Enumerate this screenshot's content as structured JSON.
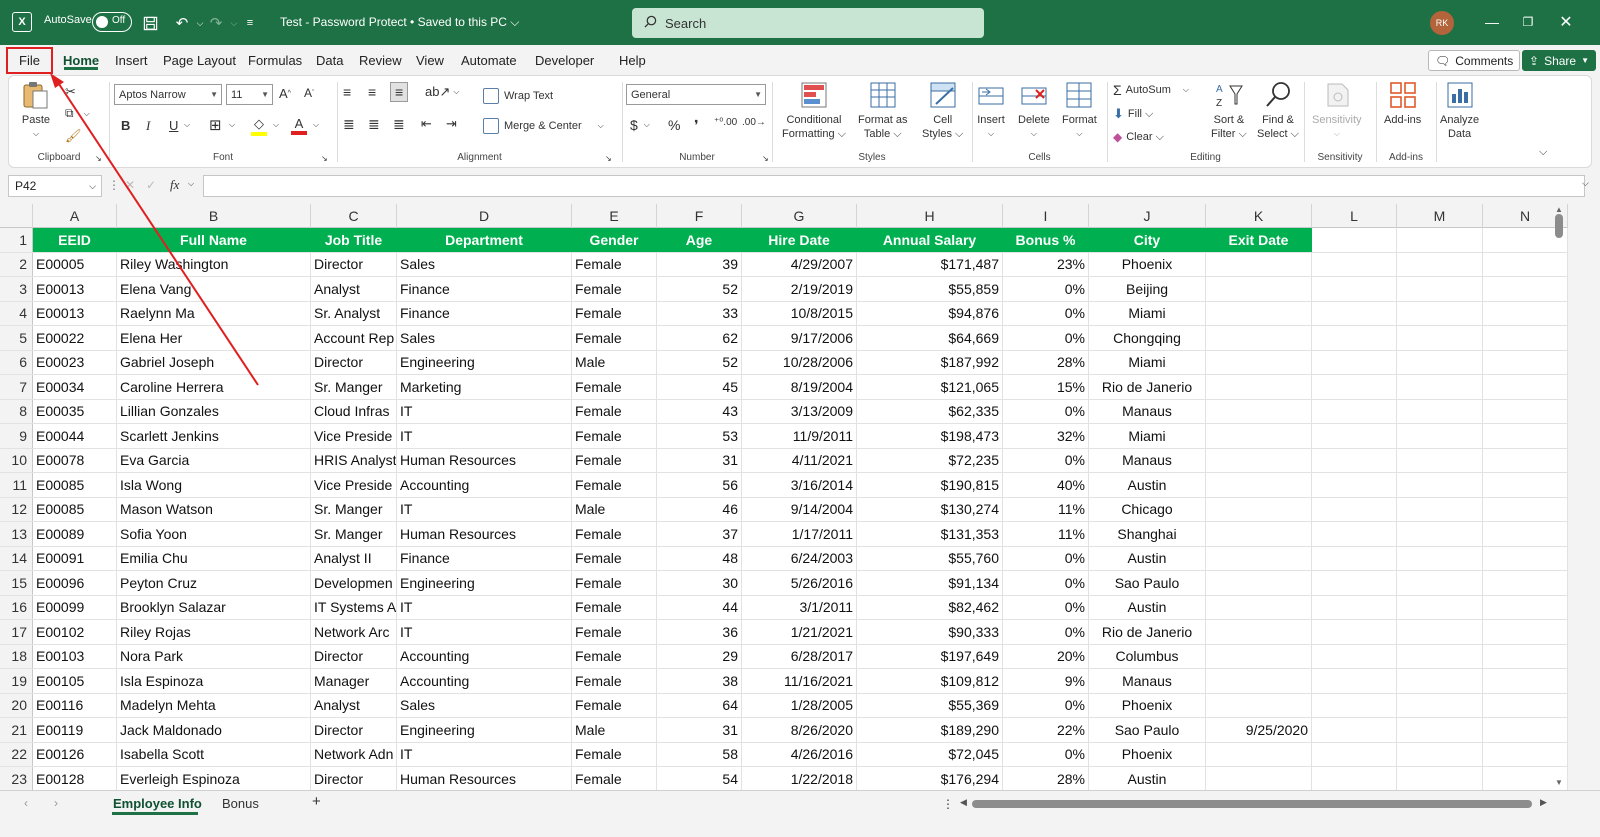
{
  "title_bar": {
    "autosave_label": "AutoSave",
    "autosave_state": "Off",
    "document_title": "Test - Password Protect • Saved to this PC ⌵",
    "search_placeholder": "Search",
    "user_initials": "RK",
    "bg_color": "#1e7145"
  },
  "menu": {
    "tabs": [
      "File",
      "Home",
      "Insert",
      "Page Layout",
      "Formulas",
      "Data",
      "Review",
      "View",
      "Automate",
      "Developer",
      "Help"
    ],
    "active_tab": "Home",
    "highlighted_tab": "File",
    "comments_label": "Comments",
    "share_label": "Share"
  },
  "ribbon": {
    "clipboard": {
      "paste": "Paste",
      "group": "Clipboard"
    },
    "font": {
      "name": "Aptos Narrow",
      "size": "11",
      "group": "Font"
    },
    "alignment": {
      "wrap": "Wrap Text",
      "merge": "Merge & Center",
      "group": "Alignment"
    },
    "number": {
      "format": "General",
      "group": "Number"
    },
    "styles": {
      "conditional_1": "Conditional",
      "conditional_2": "Formatting ⌵",
      "format_table_1": "Format as",
      "format_table_2": "Table ⌵",
      "cell_styles_1": "Cell",
      "cell_styles_2": "Styles ⌵",
      "group": "Styles"
    },
    "cells": {
      "insert": "Insert",
      "delete": "Delete",
      "format": "Format",
      "group": "Cells"
    },
    "editing": {
      "autosum": "AutoSum",
      "fill": "Fill ⌵",
      "clear": "Clear ⌵",
      "sort_1": "Sort &",
      "sort_2": "Filter ⌵",
      "find_1": "Find &",
      "find_2": "Select ⌵",
      "group": "Editing"
    },
    "sensitivity": {
      "label": "Sensitivity",
      "group": "Sensitivity"
    },
    "addins": {
      "label": "Add-ins",
      "group": "Add-ins"
    },
    "analyze": {
      "label_1": "Analyze",
      "label_2": "Data"
    }
  },
  "formula_bar": {
    "name_box": "P42",
    "fx": "fx",
    "value": ""
  },
  "columns": [
    "A",
    "B",
    "C",
    "D",
    "E",
    "F",
    "G",
    "H",
    "I",
    "J",
    "K",
    "L",
    "M",
    "N"
  ],
  "headers": [
    "EEID",
    "Full Name",
    "Job Title",
    "Department",
    "Gender",
    "Age",
    "Hire Date",
    "Annual Salary",
    "Bonus %",
    "City",
    "Exit Date"
  ],
  "rows": [
    [
      "E00005",
      "Riley Washington",
      "Director",
      "Sales",
      "Female",
      "39",
      "4/29/2007",
      "$171,487",
      "23%",
      "Phoenix",
      ""
    ],
    [
      "E00013",
      "Elena Vang",
      "Analyst",
      "Finance",
      "Female",
      "52",
      "2/19/2019",
      "$55,859",
      "0%",
      "Beijing",
      ""
    ],
    [
      "E00013",
      "Raelynn Ma",
      "Sr. Analyst",
      "Finance",
      "Female",
      "33",
      "10/8/2015",
      "$94,876",
      "0%",
      "Miami",
      ""
    ],
    [
      "E00022",
      "Elena Her",
      "Account Rep",
      "Sales",
      "Female",
      "62",
      "9/17/2006",
      "$64,669",
      "0%",
      "Chongqing",
      ""
    ],
    [
      "E00023",
      "Gabriel Joseph",
      "Director",
      "Engineering",
      "Male",
      "52",
      "10/28/2006",
      "$187,992",
      "28%",
      "Miami",
      ""
    ],
    [
      "E00034",
      "Caroline Herrera",
      "Sr. Manger",
      "Marketing",
      "Female",
      "45",
      "8/19/2004",
      "$121,065",
      "15%",
      "Rio de Janerio",
      ""
    ],
    [
      "E00035",
      "Lillian Gonzales",
      "Cloud Infras",
      "IT",
      "Female",
      "43",
      "3/13/2009",
      "$62,335",
      "0%",
      "Manaus",
      ""
    ],
    [
      "E00044",
      "Scarlett Jenkins",
      "Vice Preside",
      "IT",
      "Female",
      "53",
      "11/9/2011",
      "$198,473",
      "32%",
      "Miami",
      ""
    ],
    [
      "E00078",
      "Eva Garcia",
      "HRIS Analyst",
      "Human Resources",
      "Female",
      "31",
      "4/11/2021",
      "$72,235",
      "0%",
      "Manaus",
      ""
    ],
    [
      "E00085",
      "Isla Wong",
      "Vice Preside",
      "Accounting",
      "Female",
      "56",
      "3/16/2014",
      "$190,815",
      "40%",
      "Austin",
      ""
    ],
    [
      "E00085",
      "Mason Watson",
      "Sr. Manger",
      "IT",
      "Male",
      "46",
      "9/14/2004",
      "$130,274",
      "11%",
      "Chicago",
      ""
    ],
    [
      "E00089",
      "Sofia Yoon",
      "Sr. Manger",
      "Human Resources",
      "Female",
      "37",
      "1/17/2011",
      "$131,353",
      "11%",
      "Shanghai",
      ""
    ],
    [
      "E00091",
      "Emilia Chu",
      "Analyst II",
      "Finance",
      "Female",
      "48",
      "6/24/2003",
      "$55,760",
      "0%",
      "Austin",
      ""
    ],
    [
      "E00096",
      "Peyton Cruz",
      "Developmen",
      "Engineering",
      "Female",
      "30",
      "5/26/2016",
      "$91,134",
      "0%",
      "Sao Paulo",
      ""
    ],
    [
      "E00099",
      "Brooklyn Salazar",
      "IT Systems A",
      "IT",
      "Female",
      "44",
      "3/1/2011",
      "$82,462",
      "0%",
      "Austin",
      ""
    ],
    [
      "E00102",
      "Riley Rojas",
      "Network Arc",
      "IT",
      "Female",
      "36",
      "1/21/2021",
      "$90,333",
      "0%",
      "Rio de Janerio",
      ""
    ],
    [
      "E00103",
      "Nora Park",
      "Director",
      "Accounting",
      "Female",
      "29",
      "6/28/2017",
      "$197,649",
      "20%",
      "Columbus",
      ""
    ],
    [
      "E00105",
      "Isla Espinoza",
      "Manager",
      "Accounting",
      "Female",
      "38",
      "11/16/2021",
      "$109,812",
      "9%",
      "Manaus",
      ""
    ],
    [
      "E00116",
      "Madelyn Mehta",
      "Analyst",
      "Sales",
      "Female",
      "64",
      "1/28/2005",
      "$55,369",
      "0%",
      "Phoenix",
      ""
    ],
    [
      "E00119",
      "Jack Maldonado",
      "Director",
      "Engineering",
      "Male",
      "31",
      "8/26/2020",
      "$189,290",
      "22%",
      "Sao Paulo",
      "9/25/2020"
    ],
    [
      "E00126",
      "Isabella Scott",
      "Network Adn",
      "IT",
      "Female",
      "58",
      "4/26/2016",
      "$72,045",
      "0%",
      "Phoenix",
      ""
    ],
    [
      "E00128",
      "Everleigh Espinoza",
      "Director",
      "Human Resources",
      "Female",
      "54",
      "1/22/2018",
      "$176,294",
      "28%",
      "Austin",
      ""
    ]
  ],
  "sheets": {
    "tabs": [
      "Employee Info",
      "Bonus"
    ],
    "active": "Employee Info",
    "add": "+"
  },
  "colors": {
    "header_fill": "#00b050",
    "annotation": "#e02020",
    "accent": "#1e7145"
  }
}
